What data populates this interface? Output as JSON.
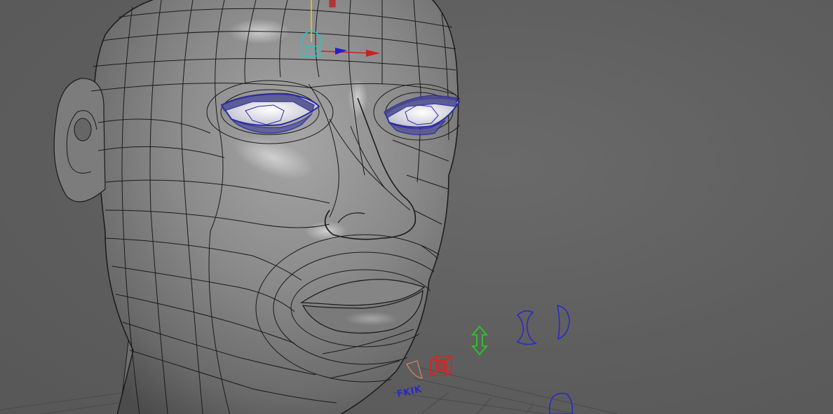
{
  "viewport": {
    "background_color": "#5f5f5f",
    "mesh_color": "#8a8a8a",
    "wireframe_color": "#1a1a1a",
    "selection_color": "#2a2aa0"
  },
  "labels": {
    "ik_label": "FKIK"
  },
  "controls": [
    {
      "name": "head-translate-manipulator",
      "icon": "translate-gizmo-icon"
    },
    {
      "name": "fk-ik-switch-control",
      "icon": "fkik-control-icon"
    },
    {
      "name": "vertical-move-control",
      "icon": "double-arrow-icon",
      "color": "#28c828"
    },
    {
      "name": "rotate-control",
      "icon": "curved-rotate-icon",
      "color": "#2a2ac8"
    },
    {
      "name": "cube-control",
      "icon": "wire-cube-icon",
      "color": "#e02020"
    }
  ]
}
